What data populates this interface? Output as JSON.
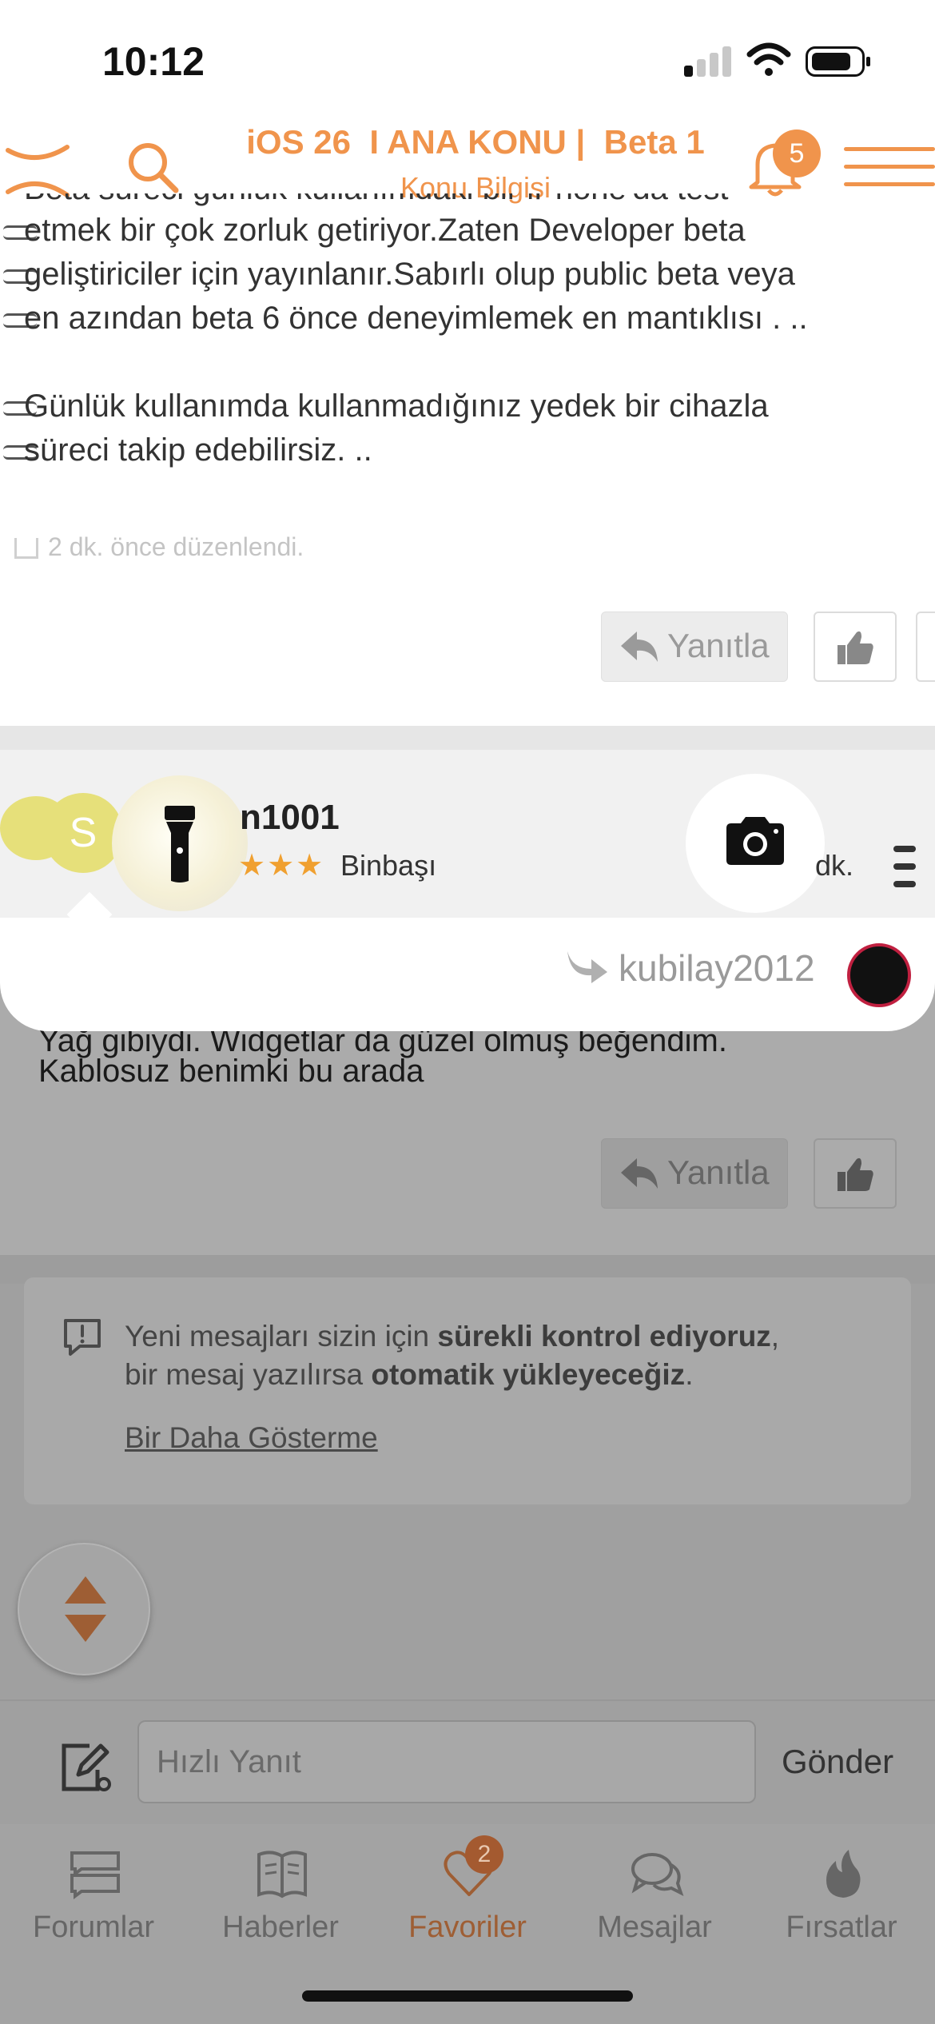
{
  "status_bar": {
    "time": "10:12"
  },
  "header": {
    "title": "iOS 26  I ANA KONU |  Beta 1",
    "subtitle": "Konu Bilgisi",
    "notification_count": "5",
    "accent_color": "#f0944c"
  },
  "post": {
    "lines": [
      "Beta süreci günlük kullanımdaki bir iPhone'da test",
      "etmek bir çok zorluk getiriyor.Zaten Developer beta",
      "geliştiriciler için yayınlanır.Sabırlı olup public beta veya",
      "en azından beta 6 önce deneyimlemek en mantıklısı . ..",
      "Günlük kullanımda kullanmadığınız yedek bir cihazla",
      "süreci takip edebilirsiz. .."
    ],
    "edited_note": "2 dk.  önce düzenlendi.",
    "reply_label": "Yanıtla"
  },
  "next_post": {
    "avatar_letter": "S",
    "username_partial": "n1001",
    "stars": "★★★",
    "rank": "Binbaşı",
    "time_partial": "dk.",
    "quoted_user": "kubilay2012",
    "lines": [
      "Yağ gibiydi. Widgetlar da güzel olmuş beğendim.",
      "Kablosuz benimki bu arada"
    ],
    "reply_label": "Yanıtla"
  },
  "notice": {
    "text_1": "Yeni mesajları sizin için ",
    "bold_1": "sürekli kontrol ediyoruz",
    "text_2": ",",
    "text_3": "bir mesaj yazılırsa ",
    "bold_2": "otomatik yükleyeceğiz",
    "text_4": ".",
    "link": "Bir Daha Gösterme"
  },
  "quick_reply": {
    "placeholder": "Hızlı Yanıt",
    "send_label": "Gönder"
  },
  "tabs": [
    {
      "label": "Forumlar",
      "icon": "forums-icon"
    },
    {
      "label": "Haberler",
      "icon": "news-icon"
    },
    {
      "label": "Favoriler",
      "icon": "heart-icon",
      "badge": "2",
      "active": true
    },
    {
      "label": "Mesajlar",
      "icon": "chat-icon"
    },
    {
      "label": "Fırsatlar",
      "icon": "fire-icon"
    }
  ],
  "overlay_controls": {
    "flashlight_icon": "flashlight-icon",
    "camera_icon": "camera-icon"
  }
}
